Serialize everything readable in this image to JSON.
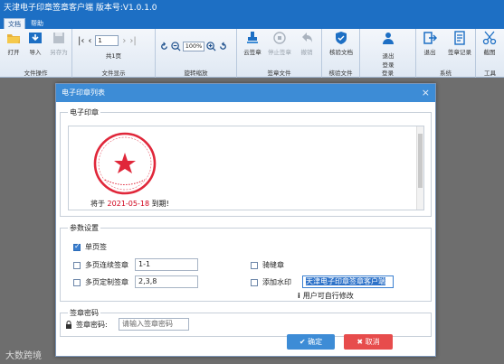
{
  "app": {
    "title": "天津电子印章签章客户端  版本号:V1.0.1.0"
  },
  "menu": {
    "tabs": [
      "文档",
      "帮助"
    ]
  },
  "ribbon": {
    "file_ops": {
      "open": "打开",
      "import": "导入",
      "save_as": "另存为",
      "group": "文件操作"
    },
    "display": {
      "page": "1",
      "page_count": "共1页",
      "group": "文件显示"
    },
    "zoom": {
      "value": "100%",
      "group": "旋转缩放"
    },
    "sign": {
      "cloud_sign": "云签章",
      "stop_sign": "停止签章",
      "revoke": "撤销",
      "group": "签章文件"
    },
    "verify": {
      "verify_doc": "核验文档",
      "group": "核验文件"
    },
    "login": {
      "logout": "退出\n登录",
      "group": "登录"
    },
    "system": {
      "exit": "退出",
      "records": "签章记录",
      "group": "系统"
    },
    "tools": {
      "screenshot": "截图",
      "group": "工具"
    }
  },
  "dialog": {
    "title": "电子印章列表",
    "seal_section": "电子印章",
    "seal_caption_prefix": "将于 ",
    "seal_date": "2021-05-18",
    "seal_caption_suffix": " 到期!",
    "params_section": "参数设置",
    "single_page": "单页签",
    "multi_continuous": "多页连续签章",
    "multi_continuous_value": "1-1",
    "multi_custom": "多页定制签章",
    "multi_custom_value": "2,3,8",
    "seam_seal": "骑缝章",
    "add_watermark": "添加水印",
    "watermark_value": "天津电子印章签章客户端",
    "custom_hint": "用户可自行修改",
    "password_section": "签章密码",
    "password_label": "签章密码:",
    "password_placeholder": "请输入签章密码",
    "ok": "确定",
    "cancel": "取消"
  },
  "watermark_overlay": "大数跨境",
  "colors": {
    "brand": "#1d6fc4",
    "dialog_header": "#3d8cd6",
    "ok": "#3d8cd6",
    "cancel": "#e74c4c",
    "seal": "#e0273a"
  }
}
